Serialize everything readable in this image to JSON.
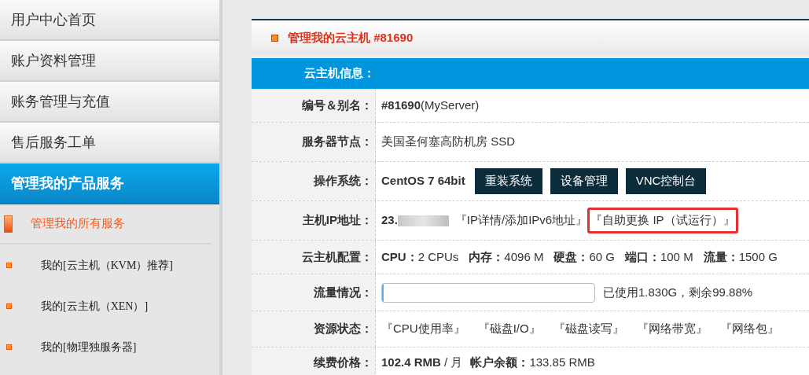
{
  "sidebar": {
    "items": [
      {
        "label": "用户中心首页",
        "selected": false
      },
      {
        "label": "账户资料管理",
        "selected": false
      },
      {
        "label": "账务管理与充值",
        "selected": false
      },
      {
        "label": "售后服务工单",
        "selected": false
      },
      {
        "label": "管理我的产品服务",
        "selected": true
      }
    ],
    "submenu": {
      "title": "管理我的所有服务",
      "items": [
        {
          "label": "我的[云主机（KVM）推荐]"
        },
        {
          "label": "我的[云主机（XEN）]"
        },
        {
          "label": "我的[物理独服务器]"
        }
      ]
    }
  },
  "panel": {
    "title": "管理我的云主机 #81690",
    "section": "云主机信息：",
    "rows": [
      {
        "kind": "text",
        "label": "编号＆别名：",
        "value_bold": "#81690",
        "value": "(MyServer)"
      },
      {
        "kind": "text",
        "label": "服务器节点：",
        "value": "美国圣何塞高防机房 SSD"
      },
      {
        "kind": "os",
        "label": "操作系统：",
        "value_bold": "CentOS 7 64bit",
        "buttons": [
          "重装系统",
          "设备管理",
          "VNC控制台"
        ]
      },
      {
        "kind": "ip",
        "label": "主机IP地址：",
        "value_bold": "23.",
        "links": [
          {
            "label": "『IP详情/添加IPv6地址』",
            "highlighted": false
          },
          {
            "label": "『自助更换 IP（试运行）』",
            "highlighted": true
          }
        ]
      },
      {
        "kind": "specs",
        "label": "云主机配置：",
        "specs": [
          {
            "name": "CPU：",
            "value": "2 CPUs"
          },
          {
            "name": "内存：",
            "value": "4096 M"
          },
          {
            "name": "硬盘：",
            "value": "60 G"
          },
          {
            "name": "端口：",
            "value": "100 M"
          },
          {
            "name": "流量：",
            "value": "1500 G"
          }
        ]
      },
      {
        "kind": "traffic",
        "label": "流量情况：",
        "level": 0.001,
        "value": "已使用1.830G，剩余99.88%"
      },
      {
        "kind": "links",
        "label": "资源状态：",
        "links": [
          "『CPU使用率』",
          "『磁盘I/O』",
          "『磁盘读写』",
          "『网络带宽』",
          "『网络包』"
        ]
      },
      {
        "kind": "price",
        "label": "续费价格：",
        "value_bold": "102.4 RMB",
        "value": " / 月",
        "balance_label": "帐户余额：",
        "balance": "133.85 RMB"
      }
    ]
  }
}
